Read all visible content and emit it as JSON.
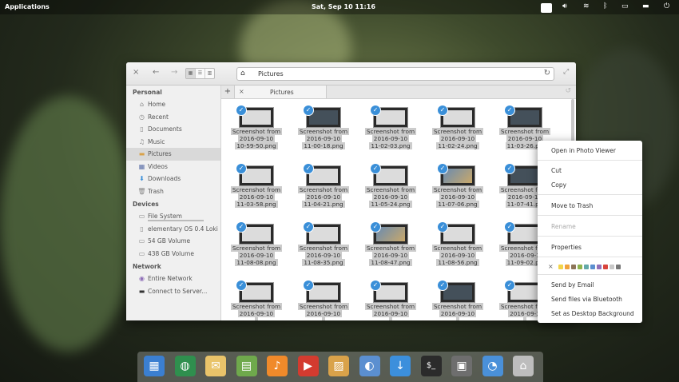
{
  "panel": {
    "applications": "Applications",
    "datetime": "Sat, Sep 10   11:16",
    "keyboard_layout": "us"
  },
  "window": {
    "location": "Pictures",
    "tab_label": "Pictures",
    "sidebar": {
      "personal_header": "Personal",
      "personal": [
        "Home",
        "Recent",
        "Documents",
        "Music",
        "Pictures",
        "Videos",
        "Downloads",
        "Trash"
      ],
      "selected": "Pictures",
      "devices_header": "Devices",
      "devices": [
        "File System",
        "elementary OS 0.4 Loki",
        "54 GB Volume",
        "438 GB Volume"
      ],
      "network_header": "Network",
      "network": [
        "Entire Network",
        "Connect to Server..."
      ]
    },
    "files": [
      {
        "l1": "Screenshot from",
        "l2": "2016-09-10",
        "l3": "10-59-50.png"
      },
      {
        "l1": "Screenshot from",
        "l2": "2016-09-10",
        "l3": "11-00-18.png"
      },
      {
        "l1": "Screenshot from",
        "l2": "2016-09-10",
        "l3": "11-02-03.png"
      },
      {
        "l1": "Screenshot from",
        "l2": "2016-09-10",
        "l3": "11-02-24.png"
      },
      {
        "l1": "Screenshot from",
        "l2": "2016-09-10",
        "l3": "11-03-26.pn"
      },
      {
        "l1": "Screenshot from",
        "l2": "2016-09-10",
        "l3": "11-03-58.png"
      },
      {
        "l1": "Screenshot from",
        "l2": "2016-09-10",
        "l3": "11-04-21.png"
      },
      {
        "l1": "Screenshot from",
        "l2": "2016-09-10",
        "l3": "11-05-24.png"
      },
      {
        "l1": "Screenshot from",
        "l2": "2016-09-10",
        "l3": "11-07-06.png"
      },
      {
        "l1": "Screenshot from",
        "l2": "2016-09-10",
        "l3": "11-07-41.pn"
      },
      {
        "l1": "Screenshot from",
        "l2": "2016-09-10",
        "l3": "11-08-08.png"
      },
      {
        "l1": "Screenshot from",
        "l2": "2016-09-10",
        "l3": "11-08-35.png"
      },
      {
        "l1": "Screenshot from",
        "l2": "2016-09-10",
        "l3": "11-08-47.png"
      },
      {
        "l1": "Screenshot from",
        "l2": "2016-09-10",
        "l3": "11-08-56.png"
      },
      {
        "l1": "Screenshot from",
        "l2": "2016-09-1",
        "l3": "11-09-02.pn"
      },
      {
        "l1": "Screenshot from",
        "l2": "2016-09-10",
        "l3": ""
      },
      {
        "l1": "Screenshot from",
        "l2": "2016-09-10",
        "l3": ""
      },
      {
        "l1": "Screenshot from",
        "l2": "2016-09-10",
        "l3": ""
      },
      {
        "l1": "Screenshot from",
        "l2": "2016-09-10",
        "l3": ""
      },
      {
        "l1": "Screenshot from",
        "l2": "2016-09-1",
        "l3": ""
      }
    ]
  },
  "context_menu": {
    "open_in": "Open in Photo Viewer",
    "cut": "Cut",
    "copy": "Copy",
    "move_to_trash": "Move to Trash",
    "rename": "Rename",
    "properties": "Properties",
    "tag_clear": "×",
    "tag_colors": [
      "#f2d44a",
      "#f0a23c",
      "#8d7559",
      "#8fb34e",
      "#63a9a8",
      "#5b8fd0",
      "#9270b8",
      "#d9443c",
      "#c8c8c8",
      "#777777"
    ],
    "send_email": "Send by Email",
    "send_bluetooth": "Send files via Bluetooth",
    "set_background": "Set as Desktop Background"
  },
  "dock": {
    "apps": [
      {
        "name": "multitasking-view-icon",
        "color": "#3b7fd1",
        "glyph": "▦"
      },
      {
        "name": "web-browser-icon",
        "color": "#2f8f4e",
        "glyph": "◍"
      },
      {
        "name": "mail-icon",
        "color": "#e9c46a",
        "glyph": "✉"
      },
      {
        "name": "calendar-icon",
        "color": "#6fa94c",
        "glyph": "▤"
      },
      {
        "name": "music-icon",
        "color": "#f08a2a",
        "glyph": "♪"
      },
      {
        "name": "videos-icon",
        "color": "#d33b2f",
        "glyph": "▶"
      },
      {
        "name": "photos-icon",
        "color": "#d9a24a",
        "glyph": "▨"
      },
      {
        "name": "switchboard-icon",
        "color": "#5b8fd0",
        "glyph": "◐"
      },
      {
        "name": "appcenter-icon",
        "color": "#3c8fdc",
        "glyph": "↓"
      },
      {
        "name": "terminal-icon",
        "color": "#2b2b2b",
        "glyph": "$_"
      },
      {
        "name": "screenshot-icon",
        "color": "#6e6e6e",
        "glyph": "▣"
      },
      {
        "name": "installer-icon",
        "color": "#4a90d9",
        "glyph": "◔"
      },
      {
        "name": "files-icon",
        "color": "#bdbdbd",
        "glyph": "⌂"
      }
    ]
  }
}
